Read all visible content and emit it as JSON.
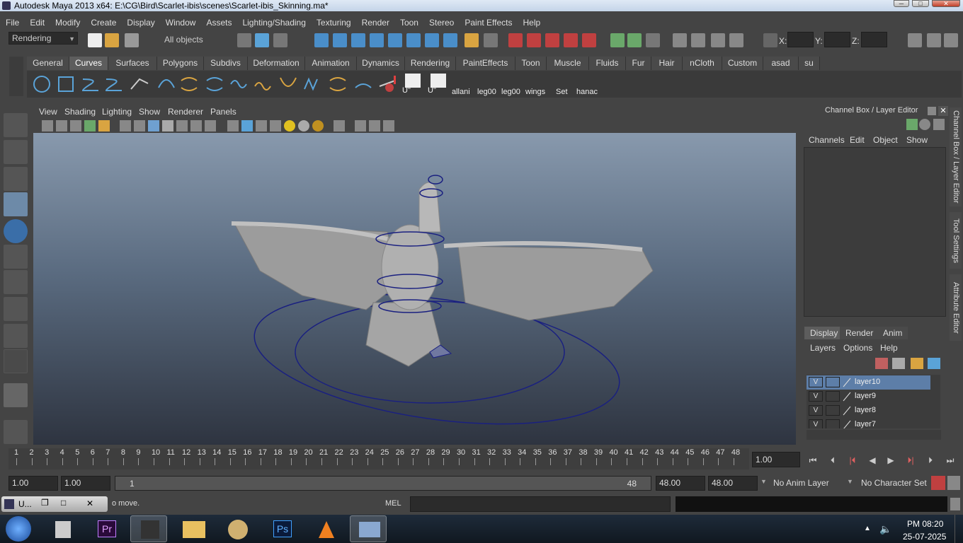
{
  "window": {
    "title": "Autodesk Maya 2013 x64: E:\\CG\\Bird\\Scarlet-ibis\\scenes\\Scarlet-ibis_Skinning.ma*",
    "min": "─",
    "max": "□",
    "close": "✕"
  },
  "menubar": [
    "File",
    "Edit",
    "Modify",
    "Create",
    "Display",
    "Window",
    "Assets",
    "Lighting/Shading",
    "Texturing",
    "Render",
    "Toon",
    "Stereo",
    "Paint Effects",
    "Help"
  ],
  "statusline": {
    "menuset": "Rendering",
    "selection_mask": "All objects",
    "x_label": "X:",
    "y_label": "Y:",
    "z_label": "Z:"
  },
  "shelf": {
    "tabs": [
      "General",
      "Curves",
      "Surfaces",
      "Polygons",
      "Subdivs",
      "Deformation",
      "Animation",
      "Dynamics",
      "Rendering",
      "PaintEffects",
      "Toon",
      "Muscle",
      "Fluids",
      "Fur",
      "Hair",
      "nCloth",
      "Custom",
      "asad",
      "su"
    ],
    "active_tab": "Curves",
    "labels": [
      "U\"",
      "U\"",
      "allani",
      "leg00",
      "leg00",
      "wings",
      "Set",
      "hanac"
    ]
  },
  "viewport": {
    "menus": [
      "View",
      "Shading",
      "Lighting",
      "Show",
      "Renderer",
      "Panels"
    ]
  },
  "channelbox": {
    "title": "Channel Box / Layer Editor",
    "menus": [
      "Channels",
      "Edit",
      "Object",
      "Show"
    ],
    "tabs": [
      "Display",
      "Render",
      "Anim"
    ],
    "active_tab": "Display",
    "layer_menus": [
      "Layers",
      "Options",
      "Help"
    ],
    "layers": [
      {
        "v": "V",
        "name": "layer10",
        "selected": true
      },
      {
        "v": "V",
        "name": "layer9",
        "selected": false
      },
      {
        "v": "V",
        "name": "layer8",
        "selected": false
      },
      {
        "v": "V",
        "name": "layer7",
        "selected": false
      }
    ]
  },
  "side_tabs": [
    "Channel Box / Layer Editor",
    "Tool Settings",
    "Attribute Editor"
  ],
  "timeline": {
    "ticks": [
      "1",
      "2",
      "3",
      "4",
      "5",
      "6",
      "7",
      "8",
      "9",
      "10",
      "11",
      "12",
      "13",
      "14",
      "15",
      "16",
      "17",
      "18",
      "19",
      "20",
      "21",
      "22",
      "23",
      "24",
      "25",
      "26",
      "27",
      "28",
      "29",
      "30",
      "31",
      "32",
      "33",
      "34",
      "35",
      "36",
      "37",
      "38",
      "39",
      "40",
      "41",
      "42",
      "43",
      "44",
      "45",
      "46",
      "47",
      "48"
    ],
    "current_time": "1.00"
  },
  "range": {
    "start": "1.00",
    "inner_start": "1.00",
    "slider_start": "1",
    "slider_end": "48",
    "end": "48.00",
    "outer_end": "48.00",
    "anim_layer": "No Anim Layer",
    "char_set": "No Character Set"
  },
  "cmdline": {
    "mini_title": "U...",
    "help_text": "o move.",
    "lang": "MEL"
  },
  "taskbar": {
    "time": "PM 08:20",
    "date": "25-07-2025",
    "pr_label": "Pr",
    "ps_label": "Ps"
  }
}
